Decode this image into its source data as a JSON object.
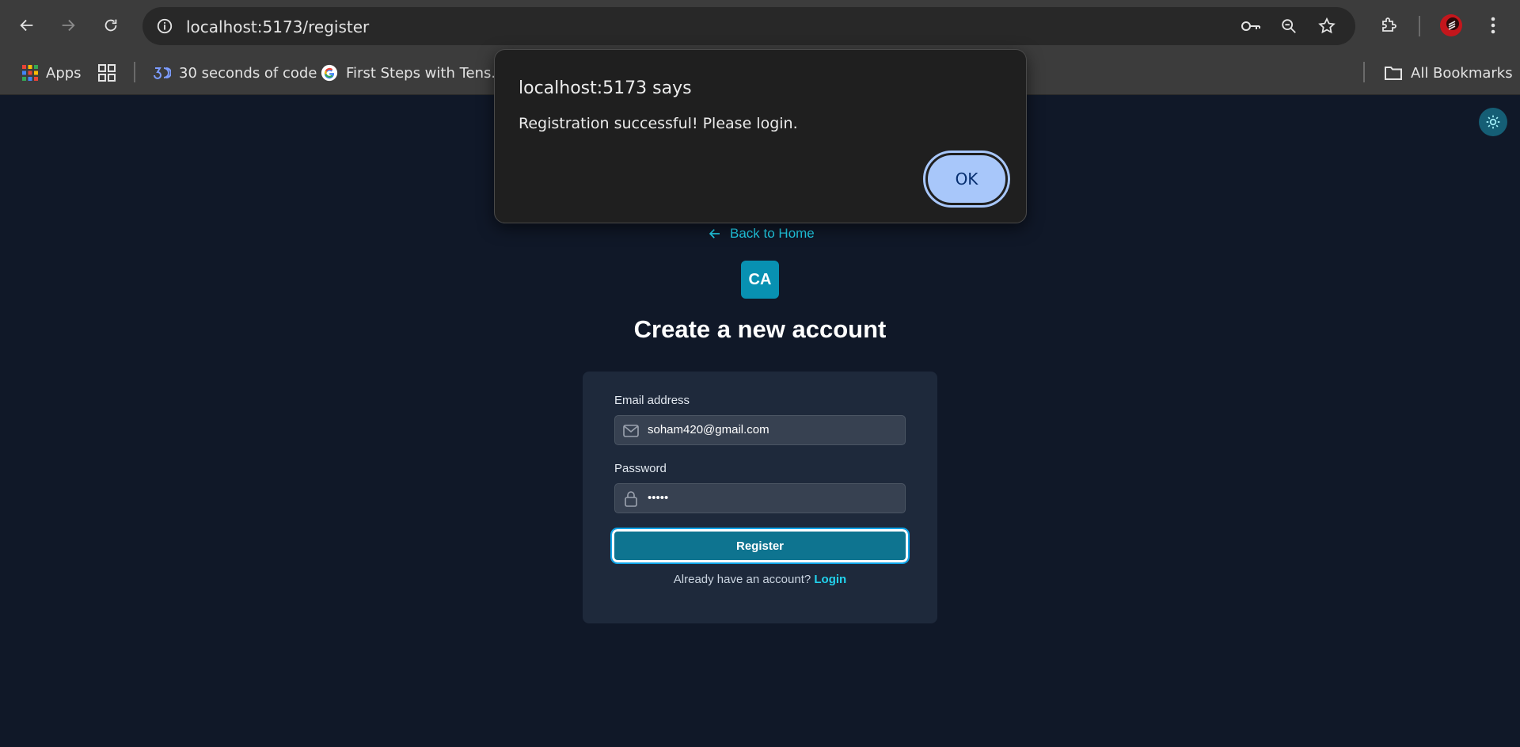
{
  "browser": {
    "url": "localhost:5173/register",
    "bookmarks": [
      {
        "label": "Apps",
        "icon": "apps-grid-icon"
      },
      {
        "label": "",
        "icon": "tab-groups-icon"
      },
      {
        "label": "30 seconds of code",
        "icon": "30-seconds-logo-icon"
      },
      {
        "label": "First Steps with Tens...",
        "icon": "google-g-icon"
      }
    ],
    "all_bookmarks": "All Bookmarks"
  },
  "dialog": {
    "title": "localhost:5173 says",
    "message": "Registration successful! Please login.",
    "ok_label": "OK"
  },
  "page": {
    "back_link": "Back to Home",
    "logo_text": "CA",
    "title": "Create a new account",
    "email_label": "Email address",
    "email_value": "soham420@gmail.com",
    "password_label": "Password",
    "password_value": "•••••",
    "register_label": "Register",
    "already_text": "Already have an account?",
    "login_link": "Login"
  },
  "colors": {
    "page_bg": "#101828",
    "card_bg": "#1e293b",
    "accent": "#22d3ee",
    "button": "#0e7490",
    "dialog_ok": "#a8c7fa"
  }
}
